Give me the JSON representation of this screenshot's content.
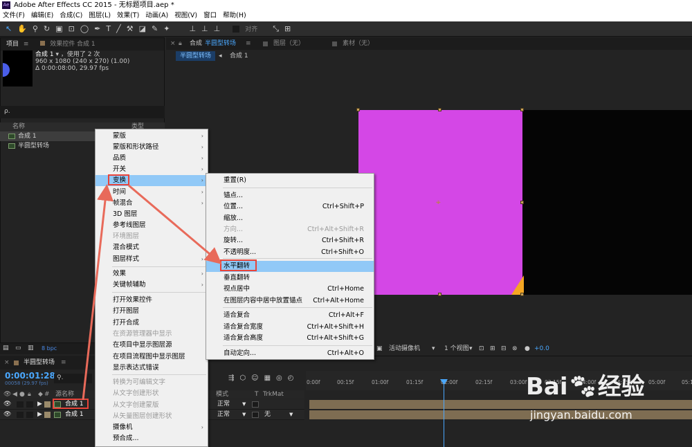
{
  "app": {
    "title": "Adobe After Effects CC 2015 - 无标题项目.aep *",
    "logo": "Ae"
  },
  "menubar": [
    "文件(F)",
    "编辑(E)",
    "合成(C)",
    "图层(L)",
    "效果(T)",
    "动画(A)",
    "视图(V)",
    "窗口",
    "帮助(H)"
  ],
  "toolbar": {
    "align_label": "对齐"
  },
  "project_panel": {
    "tab_project": "项目",
    "tab_effects": "效果控件 合成 1",
    "comp_name": "合成 1",
    "comp_used": "，使用了 2 次",
    "comp_size": "960 x 1080 (240 x 270) (1.00)",
    "comp_duration": "Δ 0:00:08:00, 29.97 fps",
    "search_placeholder": "ρ.",
    "col_name": "名称",
    "col_type": "类型",
    "items": [
      "合成 1",
      "半圆型转场"
    ],
    "bpc": "8 bpc"
  },
  "viewer": {
    "tab_comp_prefix": "合成",
    "tab_comp_name": "半圆型转场",
    "tab_layer": "图层（无）",
    "tab_footage": "素材（无）",
    "crumb_active": "半圆型转场",
    "crumb_next": "合成 1",
    "camera": "活动摄像机",
    "views": "1 个视图",
    "offset": "+0.0",
    "colors": {
      "layer": "#d447e6"
    }
  },
  "timeline": {
    "tab_name": "半圆型转场",
    "timecode": "0:00:01:28",
    "fps": "00058 (29.97 fps)",
    "col_source": "源名称",
    "col_mode": "模式",
    "col_t": "T",
    "col_trkmat": "TrkMat",
    "ruler_ticks": [
      "0:00f",
      "00:15f",
      "01:00f",
      "01:15f",
      "02:00f",
      "02:15f",
      "03:00f",
      "03:15f",
      "04:00f",
      "04:15f",
      "05:00f",
      "05:1"
    ],
    "layers": [
      {
        "num": "1",
        "name": "合成 1",
        "mode": "正常",
        "trkmat": ""
      },
      {
        "num": "1",
        "name": "合成 1",
        "mode": "正常",
        "trkmat": "无"
      }
    ]
  },
  "context_menu": {
    "items": [
      {
        "label": "蒙版",
        "sub": true
      },
      {
        "label": "蒙版和形状路径",
        "sub": true
      },
      {
        "label": "品质",
        "sub": true
      },
      {
        "label": "开关",
        "sub": true
      },
      {
        "label": "变换",
        "sub": true,
        "highlight": true
      },
      {
        "label": "时间",
        "sub": true
      },
      {
        "label": "帧混合",
        "sub": true
      },
      {
        "label": "3D 图层"
      },
      {
        "label": "参考线图层"
      },
      {
        "label": "环境图层",
        "disabled": true
      },
      {
        "label": "混合模式",
        "sub": true
      },
      {
        "label": "图层样式",
        "sub": true
      },
      {
        "label": "效果",
        "sub": true
      },
      {
        "label": "关键帧辅助",
        "sub": true
      },
      {
        "label": "打开效果控件"
      },
      {
        "label": "打开图层"
      },
      {
        "label": "打开合成"
      },
      {
        "label": "在资源管理器中显示",
        "disabled": true
      },
      {
        "label": "在项目中显示图层源"
      },
      {
        "label": "在项目流程图中显示图层"
      },
      {
        "label": "显示表达式错误"
      },
      {
        "label": "转换为可编辑文字",
        "disabled": true
      },
      {
        "label": "从文字创建形状",
        "disabled": true
      },
      {
        "label": "从文字创建蒙版",
        "disabled": true
      },
      {
        "label": "从矢量图层创建形状",
        "disabled": true
      },
      {
        "label": "摄像机",
        "sub": true
      },
      {
        "label": "预合成..."
      }
    ]
  },
  "submenu": {
    "items": [
      {
        "label": "重置(R)",
        "shortcut": ""
      },
      {
        "label": "锚点...",
        "shortcut": ""
      },
      {
        "label": "位置...",
        "shortcut": "Ctrl+Shift+P"
      },
      {
        "label": "缩放...",
        "shortcut": ""
      },
      {
        "label": "方向...",
        "shortcut": "Ctrl+Alt+Shift+R",
        "disabled": true
      },
      {
        "label": "旋转...",
        "shortcut": "Ctrl+Shift+R"
      },
      {
        "label": "不透明度...",
        "shortcut": "Ctrl+Shift+O"
      },
      {
        "label": "水平翻转",
        "shortcut": "",
        "highlight": true
      },
      {
        "label": "垂直翻转",
        "shortcut": ""
      },
      {
        "label": "视点居中",
        "shortcut": "Ctrl+Home"
      },
      {
        "label": "在图层内容中居中放置锚点",
        "shortcut": "Ctrl+Alt+Home"
      },
      {
        "label": "适合复合",
        "shortcut": "Ctrl+Alt+F"
      },
      {
        "label": "适合复合宽度",
        "shortcut": "Ctrl+Alt+Shift+H"
      },
      {
        "label": "适合复合高度",
        "shortcut": "Ctrl+Alt+Shift+G"
      },
      {
        "label": "自动定向...",
        "shortcut": "Ctrl+Alt+O"
      }
    ]
  },
  "watermark": {
    "brand": "Bai",
    "brand2": "经验",
    "url": "jingyan.baidu.com"
  }
}
